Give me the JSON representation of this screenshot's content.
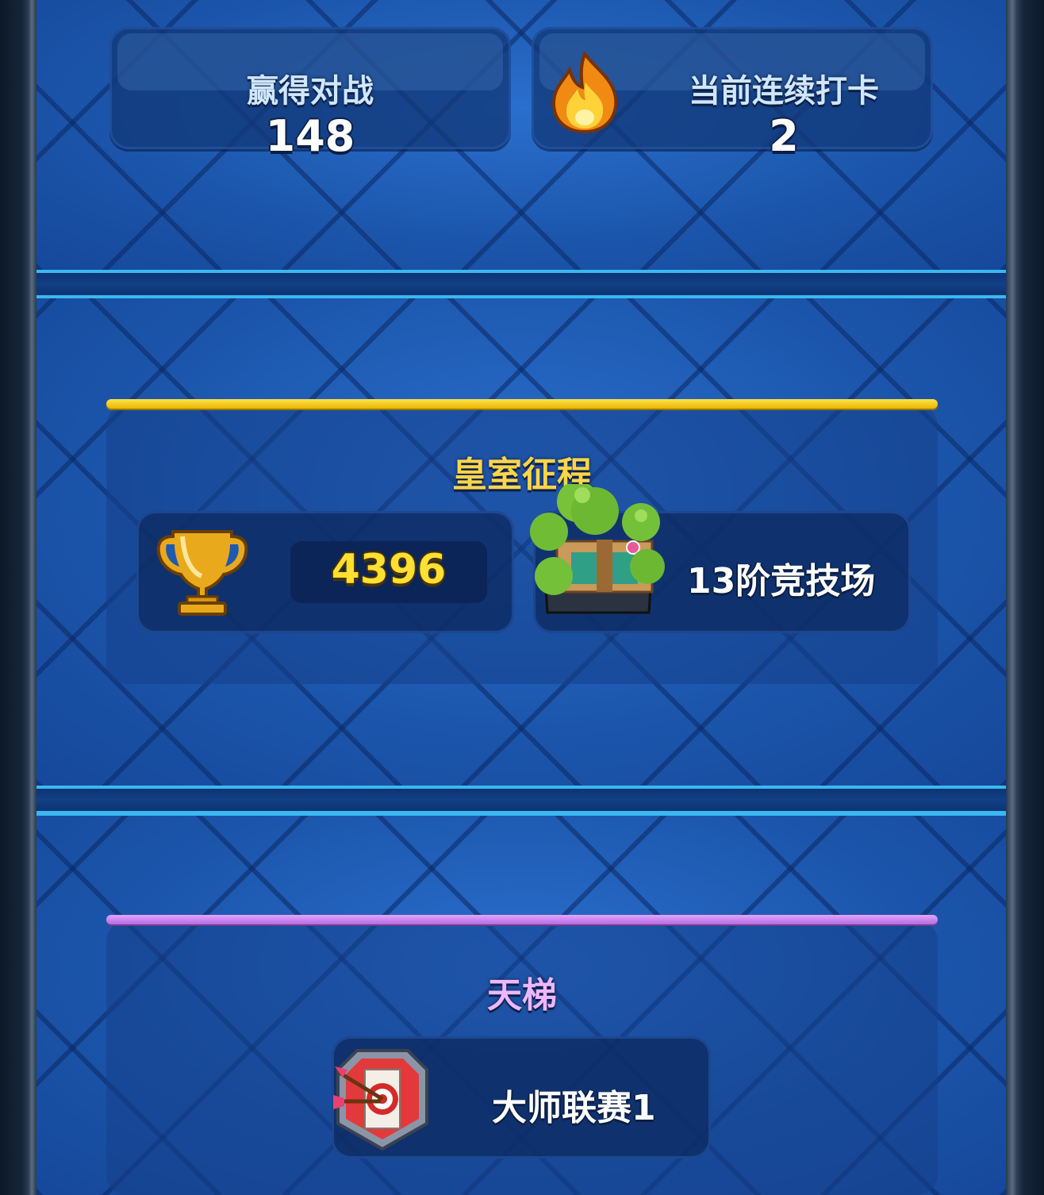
{
  "stats": {
    "wins_label": "赢得对战",
    "wins_value": "148",
    "streak_label": "当前连续打卡",
    "streak_value": "2"
  },
  "royal_road": {
    "title": "皇室征程",
    "trophies": "4396",
    "arena": "13阶竞技场"
  },
  "ladder": {
    "title": "天梯",
    "league": "大师联赛1"
  },
  "colors": {
    "panel_blue": "#1d5ab0",
    "gold_accent": "#ffd54a",
    "purple_accent": "#eeb6ff"
  },
  "icons": [
    "flame-icon",
    "trophy-icon",
    "arena-icon",
    "league-badge-icon"
  ]
}
